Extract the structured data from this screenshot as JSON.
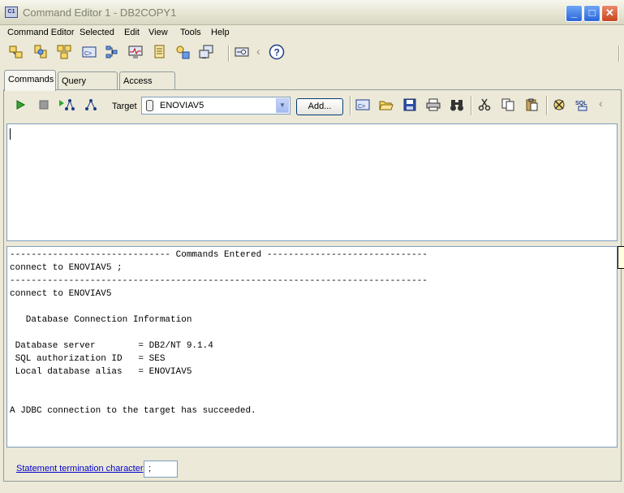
{
  "window": {
    "title": "Command Editor 1 - DB2COPY1",
    "app_icon_text": "C1"
  },
  "menu": [
    "Command Editor",
    "Selected",
    "Edit",
    "View",
    "Tools",
    "Help"
  ],
  "tabs": [
    "Commands",
    "Query Results",
    "Access Plan"
  ],
  "active_tab": "Commands",
  "target": {
    "label": "Target",
    "value": "ENOVIAV5",
    "add_label": "Add..."
  },
  "editor": {
    "content": ""
  },
  "output": {
    "lines": [
      "------------------------------ Commands Entered ------------------------------",
      "connect to ENOVIAV5 ;",
      "------------------------------------------------------------------------------",
      "connect to ENOVIAV5",
      "",
      "   Database Connection Information",
      "",
      " Database server        = DB2/NT 9.1.4",
      " SQL authorization ID   = SES",
      " Local database alias   = ENOVIAV5",
      "",
      "",
      "A JDBC connection to the target has succeeded."
    ]
  },
  "termination": {
    "label": "Statement termination character",
    "value": ";"
  },
  "colors": {
    "window_bg": "#ece9d8",
    "link": "#0000cc",
    "titlebar_text": "#8a8a7a"
  }
}
